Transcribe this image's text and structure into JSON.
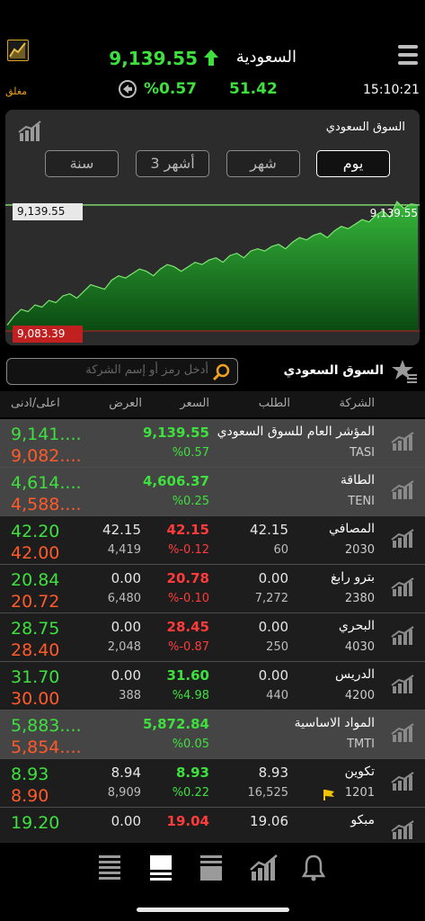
{
  "header": {
    "index_name": "السعودية",
    "index_value": "9,139.55",
    "market_status": "مغلق",
    "change_percent": "%0.57",
    "change_points": "51.42",
    "time": "15:10:21",
    "up_color": "#3ee03e"
  },
  "chart": {
    "title": "السوق السعودي",
    "ranges": [
      "يوم",
      "شهر",
      "3 أشهر",
      "سنة"
    ],
    "selected_range": "يوم",
    "high_label": "9,139.55",
    "low_label": "9,083.39",
    "current_label": "9,139.55"
  },
  "chart_data": {
    "type": "area",
    "title": "السوق السعودي",
    "ylim": [
      9083.39,
      9143.5
    ],
    "values": [
      9086,
      9090,
      9093,
      9092,
      9095,
      9094,
      9097,
      9096,
      9099,
      9100,
      9098,
      9101,
      9104,
      9103,
      9102,
      9106,
      9108,
      9107,
      9109,
      9111,
      9110,
      9108,
      9111,
      9113,
      9112,
      9110,
      9112,
      9114,
      9113,
      9115,
      9116,
      9114,
      9117,
      9118,
      9116,
      9119,
      9120,
      9119,
      9121,
      9122,
      9120,
      9123,
      9125,
      9124,
      9126,
      9127,
      9125,
      9128,
      9130,
      9129,
      9131,
      9133,
      9132,
      9135,
      9137,
      9134,
      9141,
      9138,
      9140,
      9139.55
    ]
  },
  "search": {
    "placeholder": "أدخل رمز أو إسم الشركة"
  },
  "section_title": "السوق السعودي",
  "table": {
    "headers": {
      "company": "الشركة",
      "bid": "الطلب",
      "price": "السعر",
      "ask": "العرض",
      "hilo": "اعلى/ادنى"
    },
    "rows": [
      {
        "name": "المؤشر العام للسوق السعودي",
        "code": "TASI",
        "price": "9,139.55",
        "pct": "%0.57",
        "high": "9,141....",
        "low": "9,082....",
        "bid": "",
        "bid_qty": "",
        "ask": "",
        "ask_qty": "",
        "style": "dark",
        "dir": "up"
      },
      {
        "name": "الطاقة",
        "code": "TENI",
        "price": "4,606.37",
        "pct": "%0.25",
        "high": "4,614....",
        "low": "4,588....",
        "bid": "",
        "bid_qty": "",
        "ask": "",
        "ask_qty": "",
        "style": "dark",
        "dir": "up"
      },
      {
        "name": "المصافي",
        "code": "2030",
        "price": "42.15",
        "pct": "%-0.12",
        "high": "42.20",
        "low": "42.00",
        "bid": "42.15",
        "bid_qty": "60",
        "ask": "42.15",
        "ask_qty": "4,419",
        "style": "norm",
        "dir": "dn"
      },
      {
        "name": "بترو رابغ",
        "code": "2380",
        "price": "20.78",
        "pct": "%-0.10",
        "high": "20.84",
        "low": "20.72",
        "bid": "0.00",
        "bid_qty": "7,272",
        "ask": "0.00",
        "ask_qty": "6,480",
        "style": "norm",
        "dir": "dn"
      },
      {
        "name": "البحري",
        "code": "4030",
        "price": "28.45",
        "pct": "%-0.87",
        "high": "28.75",
        "low": "28.40",
        "bid": "0.00",
        "bid_qty": "250",
        "ask": "0.00",
        "ask_qty": "2,048",
        "style": "norm",
        "dir": "dn"
      },
      {
        "name": "الدريس",
        "code": "4200",
        "price": "31.60",
        "pct": "%4.98",
        "high": "31.70",
        "low": "30.00",
        "bid": "0.00",
        "bid_qty": "440",
        "ask": "0.00",
        "ask_qty": "388",
        "style": "norm",
        "dir": "up"
      },
      {
        "name": "المواد الاساسية",
        "code": "TMTI",
        "price": "5,872.84",
        "pct": "%0.05",
        "high": "5,883....",
        "low": "5,854....",
        "bid": "",
        "bid_qty": "",
        "ask": "",
        "ask_qty": "",
        "style": "dark",
        "dir": "up"
      },
      {
        "name": "تكوين",
        "code": "1201",
        "price": "8.93",
        "pct": "%0.22",
        "high": "8.93",
        "low": "8.90",
        "bid": "8.93",
        "bid_qty": "16,525",
        "ask": "8.94",
        "ask_qty": "8,909",
        "style": "norm",
        "dir": "up",
        "flag": true
      },
      {
        "name": "مبكو",
        "code": "",
        "price": "19.04",
        "pct": "",
        "high": "19.20",
        "low": "",
        "bid": "19.06",
        "bid_qty": "",
        "ask": "0.00",
        "ask_qty": "",
        "style": "norm",
        "dir": "dn"
      }
    ]
  },
  "tabs": [
    "list-icon",
    "portfolio-icon",
    "watchlist-icon",
    "chart-icon",
    "bell-icon"
  ]
}
